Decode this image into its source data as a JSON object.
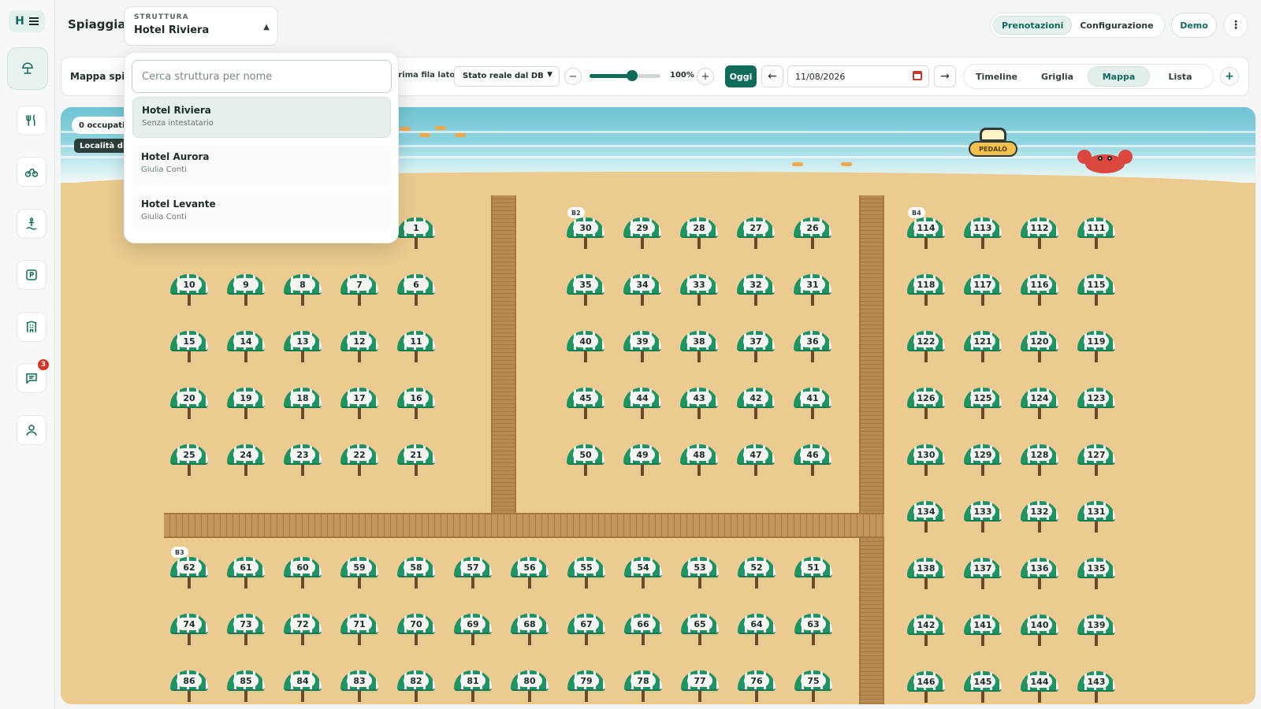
{
  "app": {
    "brand_letter": "H",
    "page_title": "Spiaggia"
  },
  "rail": {
    "items": [
      {
        "id": "beach",
        "icon": "umbrella-icon",
        "active": true
      },
      {
        "id": "restaurant",
        "icon": "fork-knife-icon"
      },
      {
        "id": "bike",
        "icon": "bicycle-icon"
      },
      {
        "id": "lifeguard",
        "icon": "lifeguard-icon"
      },
      {
        "id": "parking",
        "icon": "parking-icon"
      },
      {
        "id": "building",
        "icon": "building-icon"
      },
      {
        "id": "messages",
        "icon": "chat-icon",
        "badge": "3"
      },
      {
        "id": "profile",
        "icon": "user-icon"
      }
    ]
  },
  "header": {
    "struttura_caption": "STRUTTURA",
    "struttura_value": "Hotel Riviera",
    "mode_tabs": [
      {
        "label": "Prenotazioni",
        "active": true
      },
      {
        "label": "Configurazione",
        "active": false
      }
    ],
    "demo_label": "Demo",
    "more_label": "⋮"
  },
  "toolbar": {
    "title": "Mappa spiaggia",
    "sea_label": "Prima fila lato mare",
    "state_select": "Stato reale dal DB",
    "zoom": {
      "percent": 60,
      "label": "100%"
    },
    "today_label": "Oggi",
    "date_value": "11/08/2026",
    "views": [
      {
        "label": "Timeline",
        "active": false
      },
      {
        "label": "Griglia",
        "active": false
      },
      {
        "label": "Mappa",
        "active": true
      },
      {
        "label": "Lista",
        "active": false
      }
    ]
  },
  "map": {
    "occupied_label": "0 occupati",
    "location_label": "Località di mare",
    "pedalo_label": "PEDALÒ",
    "zones": [
      "B2",
      "B3",
      "B4"
    ],
    "rows_left": [
      [
        1
      ],
      [
        10,
        9,
        8,
        7,
        6
      ],
      [
        15,
        14,
        13,
        12,
        11
      ],
      [
        20,
        19,
        18,
        17,
        16
      ],
      [
        25,
        24,
        23,
        22,
        21
      ]
    ],
    "rows_mid": [
      [
        30,
        29,
        28,
        27,
        26
      ],
      [
        35,
        34,
        33,
        32,
        31
      ],
      [
        40,
        39,
        38,
        37,
        36
      ],
      [
        45,
        44,
        43,
        42,
        41
      ],
      [
        50,
        49,
        48,
        47,
        46
      ]
    ],
    "rows_bottom": [
      [
        62,
        61,
        60,
        59,
        58,
        57,
        56,
        55,
        54,
        53,
        52,
        51
      ],
      [
        74,
        73,
        72,
        71,
        70,
        69,
        68,
        67,
        66,
        65,
        64,
        63
      ],
      [
        86,
        85,
        84,
        83,
        82,
        81,
        80,
        79,
        78,
        77,
        76,
        75
      ]
    ],
    "rows_right": [
      [
        114,
        113,
        112,
        111
      ],
      [
        118,
        117,
        116,
        115
      ],
      [
        122,
        121,
        120,
        119
      ],
      [
        126,
        125,
        124,
        123
      ],
      [
        130,
        129,
        128,
        127
      ],
      [
        134,
        133,
        132,
        131
      ],
      [
        138,
        137,
        136,
        135
      ],
      [
        142,
        141,
        140,
        139
      ],
      [
        146,
        145,
        144,
        143
      ]
    ]
  },
  "dropdown": {
    "search_placeholder": "Cerca struttura per nome",
    "options": [
      {
        "name": "Hotel Riviera",
        "owner": "Senza intestatario",
        "selected": true
      },
      {
        "name": "Hotel Aurora",
        "owner": "Giulia Conti",
        "selected": false
      },
      {
        "name": "Hotel Levante",
        "owner": "Giulia Conti",
        "selected": false
      }
    ]
  },
  "colors": {
    "accent": "#0f6b5a",
    "umbrella_green": "#1f9463",
    "sand": "#ebcb90",
    "boardwalk": "#b88a54"
  }
}
